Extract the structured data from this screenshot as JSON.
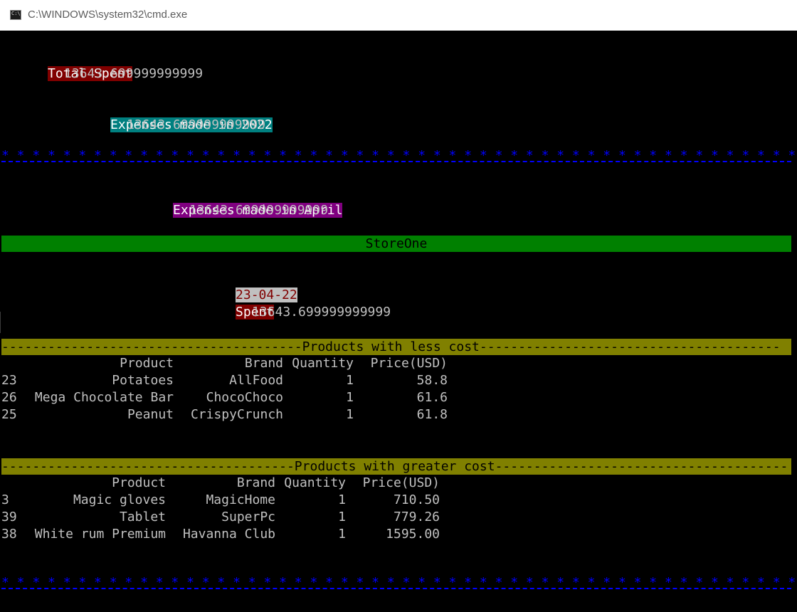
{
  "window": {
    "title": "C:\\WINDOWS\\system32\\cmd.exe",
    "icon": "cmd-icon"
  },
  "colors": {
    "console_bg": "#000000",
    "console_fg": "#c0c0c0",
    "red": "#800000",
    "teal": "#008080",
    "purple": "#800080",
    "green": "#008000",
    "olive": "#808000",
    "separator_blue": "#0000ff"
  },
  "summary": {
    "total_label": "Total Spent",
    "total_value": "13643.699999999999",
    "year_label": "Expenses made in 2022",
    "year_value": "13643.699999999999",
    "month_label": "Expenses made in April",
    "month_value": "13643.699999999999"
  },
  "separator": {
    "stars": "* * * * * * * * * * * * * * * * * * * * * * * * * * * * * * * * * * * * * * * * * * * * * * * * * * * * * * * * *"
  },
  "store": {
    "name": "StoreOne",
    "date": "23-04-22",
    "spent_label": "Spent",
    "spent_value": "13643.699999999999"
  },
  "less_cost": {
    "header": "---------------------------------------Products with less cost---------------------------------------",
    "columns": [
      "Product",
      "Brand",
      "Quantity",
      "Price(USD)"
    ],
    "rows": [
      {
        "id": "23",
        "product": "Potatoes",
        "brand": "AllFood",
        "qty": "1",
        "price": "58.8"
      },
      {
        "id": "26",
        "product": "Mega Chocolate Bar",
        "brand": "ChocoChoco",
        "qty": "1",
        "price": "61.6"
      },
      {
        "id": "25",
        "product": "Peanut",
        "brand": "CrispyCrunch",
        "qty": "1",
        "price": "61.8"
      }
    ]
  },
  "greater_cost": {
    "header": "--------------------------------------Products with greater cost--------------------------------------",
    "columns": [
      "Product",
      "Brand",
      "Quantity",
      "Price(USD)"
    ],
    "rows": [
      {
        "id": "3",
        "product": "Magic gloves",
        "brand": "MagicHome",
        "qty": "1",
        "price": "710.50"
      },
      {
        "id": "39",
        "product": "Tablet",
        "brand": "SuperPc",
        "qty": "1",
        "price": "779.26"
      },
      {
        "id": "38",
        "product": "White rum Premium",
        "brand": "Havanna Club",
        "qty": "1",
        "price": "1595.00"
      }
    ]
  }
}
